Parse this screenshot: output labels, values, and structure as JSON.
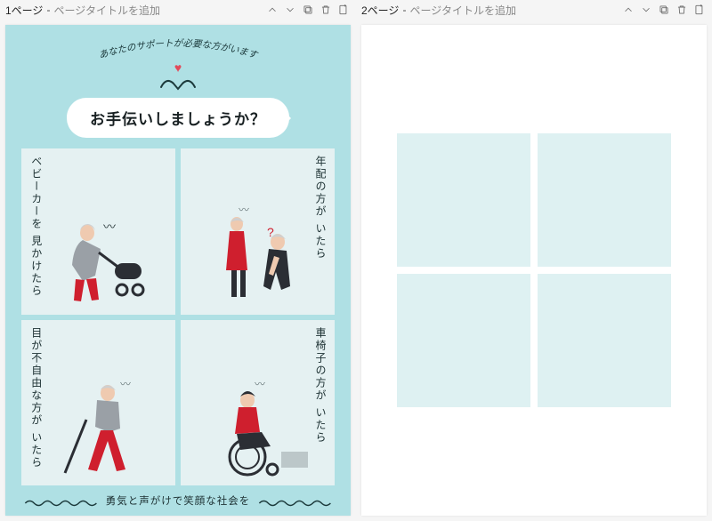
{
  "pages": [
    {
      "num": "1ページ",
      "title_placeholder": "ページタイトルを追加"
    },
    {
      "num": "2ページ",
      "title_placeholder": "ページタイトルを追加"
    }
  ],
  "flyer": {
    "arc_text": "あなたのサポートが必要な方がいます",
    "bubble": "お手伝いしましょうか？",
    "cells": [
      {
        "label": "ベビーカーを\n見かけたら",
        "side": "left"
      },
      {
        "label": "年配の方が\nいたら",
        "side": "right"
      },
      {
        "label": "目が不自由な方が\nいたら",
        "side": "left"
      },
      {
        "label": "車椅子の方が\nいたら",
        "side": "right"
      }
    ],
    "tagline": "勇気と声がけで笑顔な社会を"
  },
  "icons": {
    "chevron_up": "chevron-up-icon",
    "chevron_down": "chevron-down-icon",
    "duplicate": "duplicate-icon",
    "trash": "trash-icon",
    "add_page": "add-page-icon"
  }
}
